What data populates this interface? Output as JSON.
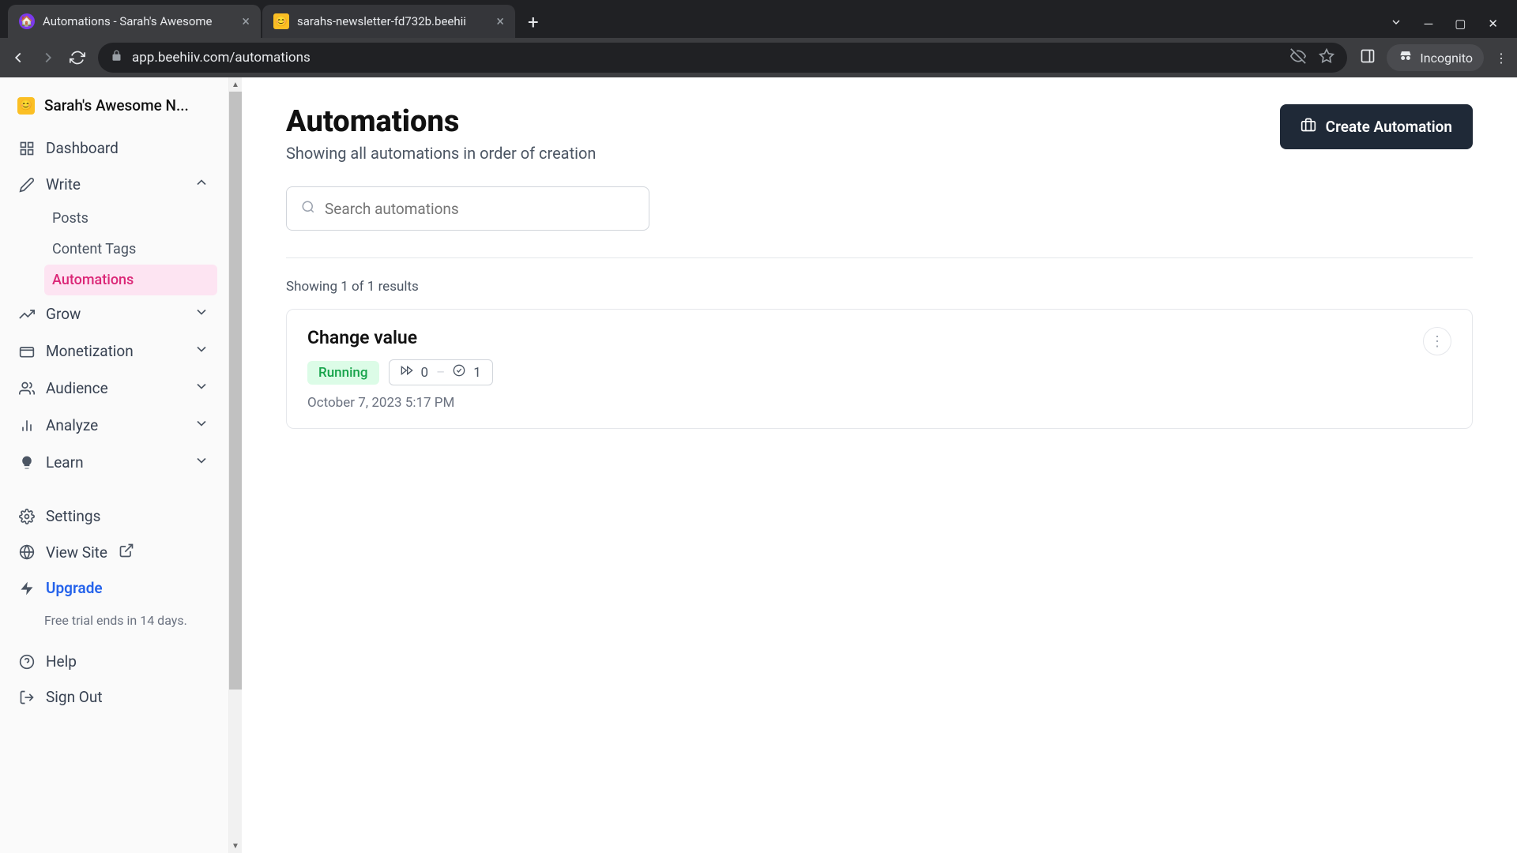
{
  "browser": {
    "tabs": [
      {
        "title": "Automations - Sarah's Awesome"
      },
      {
        "title": "sarahs-newsletter-fd732b.beehii"
      }
    ],
    "url": "app.beehiiv.com/automations",
    "incognito_label": "Incognito"
  },
  "sidebar": {
    "workspace": "Sarah's Awesome N...",
    "items": {
      "dashboard": "Dashboard",
      "write": "Write",
      "posts": "Posts",
      "content_tags": "Content Tags",
      "automations": "Automations",
      "grow": "Grow",
      "monetization": "Monetization",
      "audience": "Audience",
      "analyze": "Analyze",
      "learn": "Learn",
      "settings": "Settings",
      "view_site": "View Site",
      "upgrade": "Upgrade",
      "help": "Help",
      "sign_out": "Sign Out"
    },
    "trial": "Free trial ends in 14 days."
  },
  "main": {
    "title": "Automations",
    "subtitle": "Showing all automations in order of creation",
    "create_label": "Create Automation",
    "search_placeholder": "Search automations",
    "results_text": "Showing 1 of 1 results",
    "automation": {
      "name": "Change value",
      "status": "Running",
      "running_count": "0",
      "completed_count": "1",
      "timestamp": "October 7, 2023 5:17 PM"
    }
  }
}
